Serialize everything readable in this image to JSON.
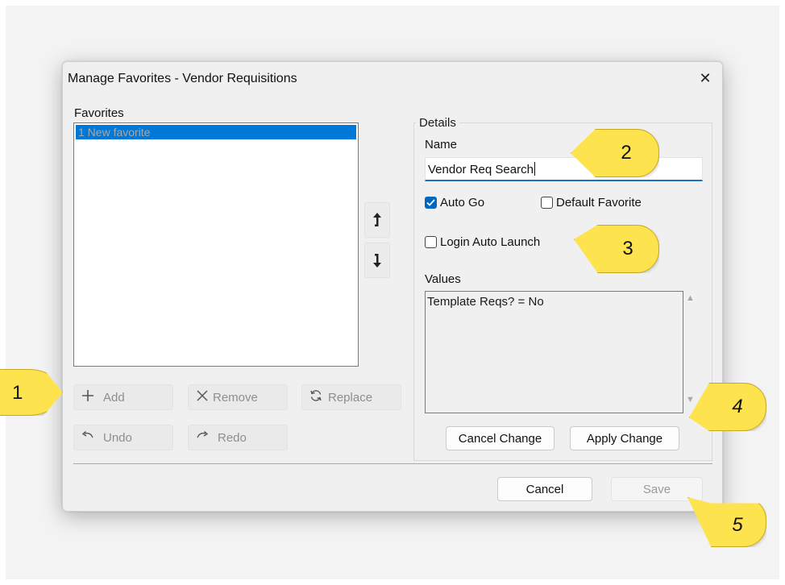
{
  "dialog": {
    "title": "Manage Favorites - Vendor Requisitions",
    "close_glyph": "✕"
  },
  "favorites": {
    "label": "Favorites",
    "items": [
      "1 New favorite"
    ],
    "selected_index": 0
  },
  "list_buttons": {
    "add": "Add",
    "remove": "Remove",
    "replace": "Replace",
    "undo": "Undo",
    "redo": "Redo"
  },
  "move_buttons": {
    "up_icon": "arrow-up-icon",
    "down_icon": "arrow-down-icon"
  },
  "details": {
    "legend": "Details",
    "name_label": "Name",
    "name_value": "Vendor Req Search",
    "auto_go": {
      "label": "Auto Go",
      "checked": true
    },
    "default_favorite": {
      "label": "Default Favorite",
      "checked": false
    },
    "login_auto_launch": {
      "label": "Login Auto Launch",
      "checked": false
    },
    "values_label": "Values",
    "values_text": "Template Reqs? = No",
    "cancel_change": "Cancel Change",
    "apply_change": "Apply Change"
  },
  "footer": {
    "cancel": "Cancel",
    "save": "Save"
  },
  "callouts": [
    "1",
    "2",
    "3",
    "4",
    "5"
  ],
  "colors": {
    "accent": "#0078d7",
    "callout": "#fde34e",
    "dialog_bg": "#f0f0f0"
  }
}
